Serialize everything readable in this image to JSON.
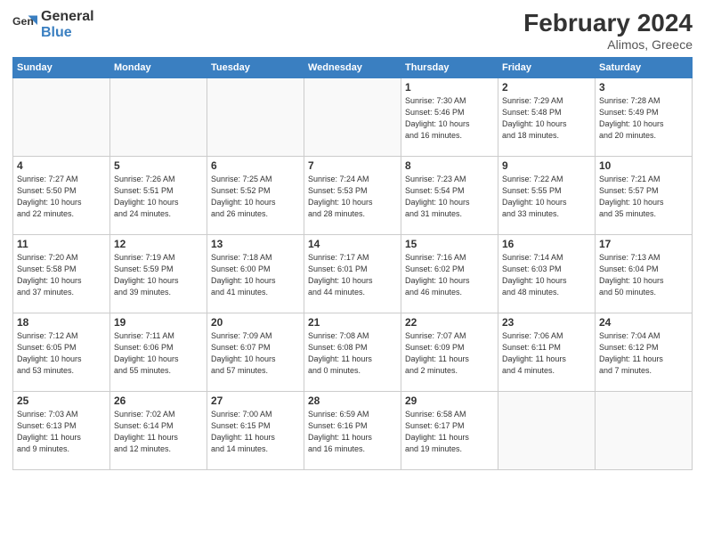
{
  "header": {
    "logo_text_general": "General",
    "logo_text_blue": "Blue",
    "month_year": "February 2024",
    "location": "Alimos, Greece"
  },
  "days_of_week": [
    "Sunday",
    "Monday",
    "Tuesday",
    "Wednesday",
    "Thursday",
    "Friday",
    "Saturday"
  ],
  "weeks": [
    [
      {
        "day": "",
        "info": ""
      },
      {
        "day": "",
        "info": ""
      },
      {
        "day": "",
        "info": ""
      },
      {
        "day": "",
        "info": ""
      },
      {
        "day": "1",
        "info": "Sunrise: 7:30 AM\nSunset: 5:46 PM\nDaylight: 10 hours\nand 16 minutes."
      },
      {
        "day": "2",
        "info": "Sunrise: 7:29 AM\nSunset: 5:48 PM\nDaylight: 10 hours\nand 18 minutes."
      },
      {
        "day": "3",
        "info": "Sunrise: 7:28 AM\nSunset: 5:49 PM\nDaylight: 10 hours\nand 20 minutes."
      }
    ],
    [
      {
        "day": "4",
        "info": "Sunrise: 7:27 AM\nSunset: 5:50 PM\nDaylight: 10 hours\nand 22 minutes."
      },
      {
        "day": "5",
        "info": "Sunrise: 7:26 AM\nSunset: 5:51 PM\nDaylight: 10 hours\nand 24 minutes."
      },
      {
        "day": "6",
        "info": "Sunrise: 7:25 AM\nSunset: 5:52 PM\nDaylight: 10 hours\nand 26 minutes."
      },
      {
        "day": "7",
        "info": "Sunrise: 7:24 AM\nSunset: 5:53 PM\nDaylight: 10 hours\nand 28 minutes."
      },
      {
        "day": "8",
        "info": "Sunrise: 7:23 AM\nSunset: 5:54 PM\nDaylight: 10 hours\nand 31 minutes."
      },
      {
        "day": "9",
        "info": "Sunrise: 7:22 AM\nSunset: 5:55 PM\nDaylight: 10 hours\nand 33 minutes."
      },
      {
        "day": "10",
        "info": "Sunrise: 7:21 AM\nSunset: 5:57 PM\nDaylight: 10 hours\nand 35 minutes."
      }
    ],
    [
      {
        "day": "11",
        "info": "Sunrise: 7:20 AM\nSunset: 5:58 PM\nDaylight: 10 hours\nand 37 minutes."
      },
      {
        "day": "12",
        "info": "Sunrise: 7:19 AM\nSunset: 5:59 PM\nDaylight: 10 hours\nand 39 minutes."
      },
      {
        "day": "13",
        "info": "Sunrise: 7:18 AM\nSunset: 6:00 PM\nDaylight: 10 hours\nand 41 minutes."
      },
      {
        "day": "14",
        "info": "Sunrise: 7:17 AM\nSunset: 6:01 PM\nDaylight: 10 hours\nand 44 minutes."
      },
      {
        "day": "15",
        "info": "Sunrise: 7:16 AM\nSunset: 6:02 PM\nDaylight: 10 hours\nand 46 minutes."
      },
      {
        "day": "16",
        "info": "Sunrise: 7:14 AM\nSunset: 6:03 PM\nDaylight: 10 hours\nand 48 minutes."
      },
      {
        "day": "17",
        "info": "Sunrise: 7:13 AM\nSunset: 6:04 PM\nDaylight: 10 hours\nand 50 minutes."
      }
    ],
    [
      {
        "day": "18",
        "info": "Sunrise: 7:12 AM\nSunset: 6:05 PM\nDaylight: 10 hours\nand 53 minutes."
      },
      {
        "day": "19",
        "info": "Sunrise: 7:11 AM\nSunset: 6:06 PM\nDaylight: 10 hours\nand 55 minutes."
      },
      {
        "day": "20",
        "info": "Sunrise: 7:09 AM\nSunset: 6:07 PM\nDaylight: 10 hours\nand 57 minutes."
      },
      {
        "day": "21",
        "info": "Sunrise: 7:08 AM\nSunset: 6:08 PM\nDaylight: 11 hours\nand 0 minutes."
      },
      {
        "day": "22",
        "info": "Sunrise: 7:07 AM\nSunset: 6:09 PM\nDaylight: 11 hours\nand 2 minutes."
      },
      {
        "day": "23",
        "info": "Sunrise: 7:06 AM\nSunset: 6:11 PM\nDaylight: 11 hours\nand 4 minutes."
      },
      {
        "day": "24",
        "info": "Sunrise: 7:04 AM\nSunset: 6:12 PM\nDaylight: 11 hours\nand 7 minutes."
      }
    ],
    [
      {
        "day": "25",
        "info": "Sunrise: 7:03 AM\nSunset: 6:13 PM\nDaylight: 11 hours\nand 9 minutes."
      },
      {
        "day": "26",
        "info": "Sunrise: 7:02 AM\nSunset: 6:14 PM\nDaylight: 11 hours\nand 12 minutes."
      },
      {
        "day": "27",
        "info": "Sunrise: 7:00 AM\nSunset: 6:15 PM\nDaylight: 11 hours\nand 14 minutes."
      },
      {
        "day": "28",
        "info": "Sunrise: 6:59 AM\nSunset: 6:16 PM\nDaylight: 11 hours\nand 16 minutes."
      },
      {
        "day": "29",
        "info": "Sunrise: 6:58 AM\nSunset: 6:17 PM\nDaylight: 11 hours\nand 19 minutes."
      },
      {
        "day": "",
        "info": ""
      },
      {
        "day": "",
        "info": ""
      }
    ]
  ]
}
